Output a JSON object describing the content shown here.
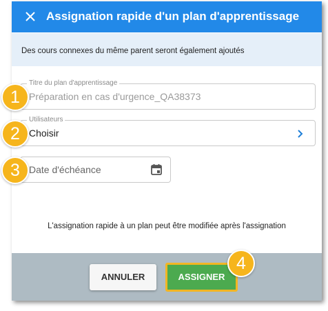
{
  "dialog": {
    "title": "Assignation rapide d'un plan d'apprentissage",
    "close_icon": "close-icon",
    "info": "Des cours connexes du même parent seront également ajoutés"
  },
  "fields": {
    "title": {
      "label": "Titre du plan d'apprentissage",
      "value": "Préparation en cas d'urgence_QA38373"
    },
    "users": {
      "label": "Utilisateurs",
      "value": "Choisir",
      "icon": "chevron-right-icon"
    },
    "due_date": {
      "placeholder": "Date d'échéance",
      "icon": "calendar-icon"
    }
  },
  "note": "L'assignation rapide à un plan peut être modifiée après l'assignation",
  "footer": {
    "cancel_label": "ANNULER",
    "assign_label": "ASSIGNER"
  },
  "callouts": [
    "1",
    "2",
    "3",
    "4"
  ],
  "colors": {
    "header": "#2289e8",
    "info_band": "#e5eff9",
    "footer": "#aebbc3",
    "assign_button": "#4caa4f",
    "callout": "#f6b51c"
  }
}
